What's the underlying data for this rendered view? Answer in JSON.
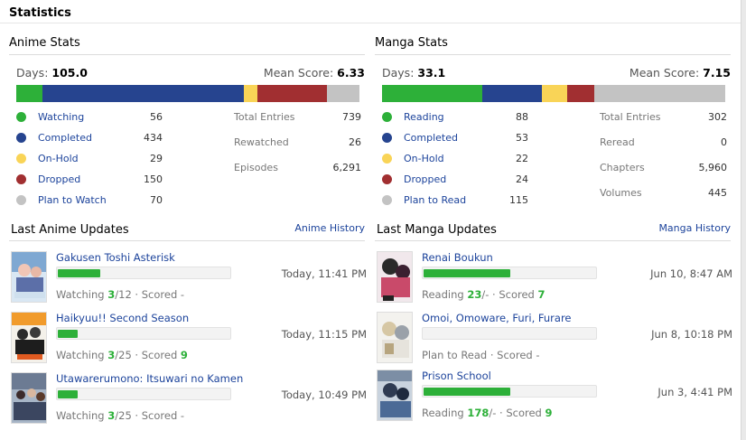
{
  "page": {
    "title": "Statistics"
  },
  "colors": {
    "watching": "#2db039",
    "completed": "#26448f",
    "on_hold": "#f9d457",
    "dropped": "#a12f31",
    "plan": "#c3c3c3",
    "link": "#1c439b"
  },
  "anime": {
    "heading": "Anime Stats",
    "days_label": "Days:",
    "days_value": "105.0",
    "mean_label": "Mean Score:",
    "mean_value": "6.33",
    "statuses": [
      {
        "label": "Watching",
        "count": "56",
        "color": "#2db039",
        "value": 56
      },
      {
        "label": "Completed",
        "count": "434",
        "color": "#26448f",
        "value": 434
      },
      {
        "label": "On-Hold",
        "count": "29",
        "color": "#f9d457",
        "value": 29
      },
      {
        "label": "Dropped",
        "count": "150",
        "color": "#a12f31",
        "value": 150
      },
      {
        "label": "Plan to Watch",
        "count": "70",
        "color": "#c3c3c3",
        "value": 70
      }
    ],
    "totals": [
      {
        "label": "Total Entries",
        "value": "739"
      },
      {
        "label": "Rewatched",
        "value": "26"
      },
      {
        "label": "Episodes",
        "value": "6,291"
      }
    ],
    "updates_heading": "Last Anime Updates",
    "history_link": "Anime History",
    "updates": [
      {
        "title": "Gakusen Toshi Asterisk",
        "time": "Today, 11:41 PM",
        "status_pre": "Watching ",
        "progress": "3",
        "status_post": "/12 · Scored -",
        "fraction": 0.25
      },
      {
        "title": "Haikyuu!! Second Season",
        "time": "Today, 11:15 PM",
        "status_pre": "Watching ",
        "progress": "3",
        "status_post": "/25 · Scored ",
        "score": "9",
        "fraction": 0.12
      },
      {
        "title": "Utawarerumono: Itsuwari no Kamen",
        "time": "Today, 10:49 PM",
        "status_pre": "Watching ",
        "progress": "3",
        "status_post": "/25 · Scored -",
        "fraction": 0.12
      }
    ]
  },
  "manga": {
    "heading": "Manga Stats",
    "days_label": "Days:",
    "days_value": "33.1",
    "mean_label": "Mean Score:",
    "mean_value": "7.15",
    "statuses": [
      {
        "label": "Reading",
        "count": "88",
        "color": "#2db039",
        "value": 88
      },
      {
        "label": "Completed",
        "count": "53",
        "color": "#26448f",
        "value": 53
      },
      {
        "label": "On-Hold",
        "count": "22",
        "color": "#f9d457",
        "value": 22
      },
      {
        "label": "Dropped",
        "count": "24",
        "color": "#a12f31",
        "value": 24
      },
      {
        "label": "Plan to Read",
        "count": "115",
        "color": "#c3c3c3",
        "value": 115
      }
    ],
    "totals": [
      {
        "label": "Total Entries",
        "value": "302"
      },
      {
        "label": "Reread",
        "value": "0"
      },
      {
        "label": "Chapters",
        "value": "5,960"
      },
      {
        "label": "Volumes",
        "value": "445"
      }
    ],
    "updates_heading": "Last Manga Updates",
    "history_link": "Manga History",
    "updates": [
      {
        "title": "Renai Boukun",
        "time": "Jun 10, 8:47 AM",
        "status_pre": "Reading ",
        "progress": "23",
        "status_post": "/- · Scored ",
        "score": "7",
        "fraction": 0.5
      },
      {
        "title": "Omoi, Omoware, Furi, Furare",
        "time": "Jun 8, 10:18 PM",
        "status_pre": "Plan to Read · Scored -",
        "progress": "",
        "status_post": "",
        "fraction": 0
      },
      {
        "title": "Prison School",
        "time": "Jun 3, 4:41 PM",
        "status_pre": "Reading ",
        "progress": "178",
        "status_post": "/- · Scored ",
        "score": "9",
        "fraction": 0.5
      }
    ]
  }
}
